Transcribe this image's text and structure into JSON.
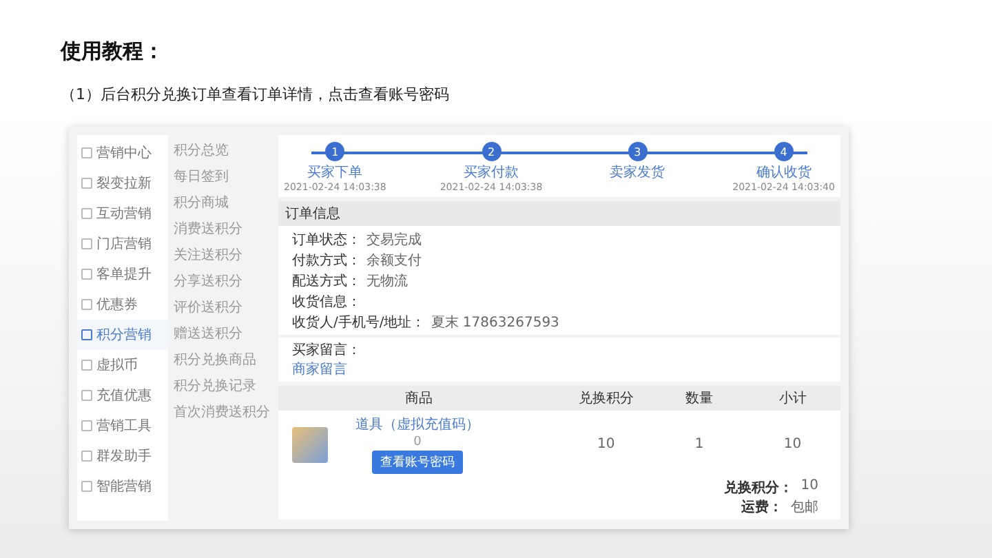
{
  "title": "使用教程：",
  "subtitle": "（1）后台积分兑换订单查看订单详情，点击查看账号密码",
  "sidebar": {
    "items": [
      {
        "label": "营销中心",
        "selected": false
      },
      {
        "label": "裂变拉新",
        "selected": false
      },
      {
        "label": "互动营销",
        "selected": false
      },
      {
        "label": "门店营销",
        "selected": false
      },
      {
        "label": "客单提升",
        "selected": false
      },
      {
        "label": "优惠券",
        "selected": false
      },
      {
        "label": "积分营销",
        "selected": true
      },
      {
        "label": "虚拟币",
        "selected": false
      },
      {
        "label": "充值优惠",
        "selected": false
      },
      {
        "label": "营销工具",
        "selected": false
      },
      {
        "label": "群发助手",
        "selected": false
      },
      {
        "label": "智能营销",
        "selected": false
      }
    ]
  },
  "submenu": {
    "items": [
      "积分总览",
      "每日签到",
      "积分商城",
      "消费送积分",
      "关注送积分",
      "分享送积分",
      "评价送积分",
      "赠送送积分",
      "积分兑换商品",
      "积分兑换记录",
      "首次消费送积分"
    ]
  },
  "steps": [
    {
      "number": "1",
      "label": "买家下单",
      "time": "2021-02-24 14:03:38"
    },
    {
      "number": "2",
      "label": "买家付款",
      "time": "2021-02-24 14:03:38"
    },
    {
      "number": "3",
      "label": "卖家发货"
    },
    {
      "number": "4",
      "label": "确认收货",
      "time": "2021-02-24 14:03:40"
    }
  ],
  "order_info": {
    "heading": "订单信息",
    "fields": [
      {
        "label": "订单状态：",
        "value": "交易完成"
      },
      {
        "label": "付款方式：",
        "value": "余额支付"
      },
      {
        "label": "配送方式：",
        "value": "无物流"
      },
      {
        "label": "收货信息："
      },
      {
        "label": "收货人/手机号/地址：",
        "value": "夏末  17863267593"
      }
    ],
    "note_label": "买家留言：",
    "note_link": "商家留言"
  },
  "table": {
    "columns": [
      "商品",
      "兑换积分",
      "数量",
      "小计"
    ],
    "rows": [
      {
        "name": "道具（虚拟充值码）",
        "sub": "0",
        "button": "查看账号密码",
        "points": "10",
        "qty": "1",
        "subtotal": "10"
      }
    ]
  },
  "totals": [
    {
      "label": "兑换积分：",
      "value": "10"
    },
    {
      "label": "运费：",
      "value": "包邮"
    }
  ]
}
